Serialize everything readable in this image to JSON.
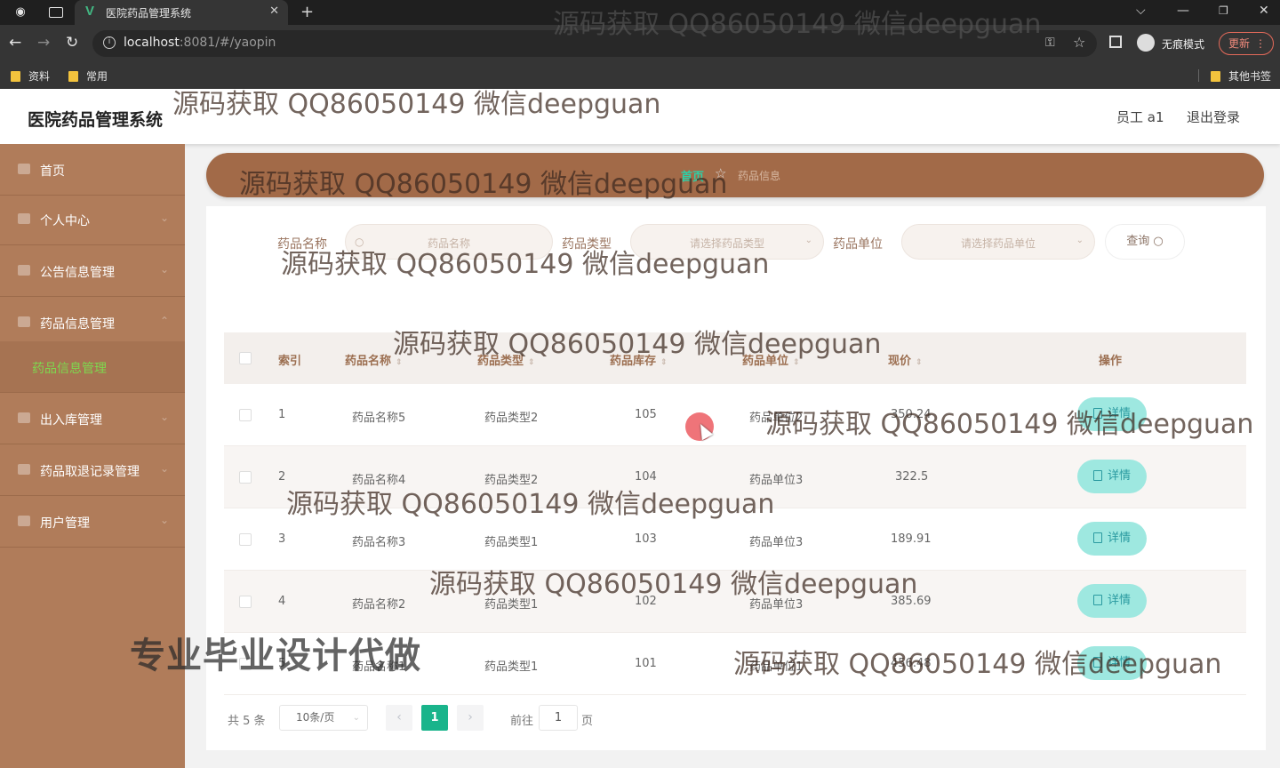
{
  "browser": {
    "tab_title": "医院药品管理系统",
    "url_host": "localhost",
    "url_rest": ":8081/#/yaopin",
    "incognito_label": "无痕模式",
    "update_label": "更新",
    "bookmarks": [
      "资料",
      "常用"
    ],
    "other_bookmarks": "其他书签"
  },
  "header": {
    "title": "医院药品管理系统",
    "user": "员工 a1",
    "logout": "退出登录"
  },
  "sidebar": {
    "items": [
      {
        "label": "首页"
      },
      {
        "label": "个人中心"
      },
      {
        "label": "公告信息管理"
      },
      {
        "label": "药品信息管理"
      },
      {
        "label": "出入库管理"
      },
      {
        "label": "药品取退记录管理"
      },
      {
        "label": "用户管理"
      }
    ],
    "active_sub": "药品信息管理"
  },
  "breadcrumb": {
    "home": "首页",
    "current": "药品信息"
  },
  "filters": {
    "name_label": "药品名称",
    "name_placeholder": "药品名称",
    "type_label": "药品类型",
    "type_placeholder": "请选择药品类型",
    "unit_label": "药品单位",
    "unit_placeholder": "请选择药品单位",
    "query_button": "查询"
  },
  "table": {
    "headers": [
      "索引",
      "药品名称",
      "药品类型",
      "药品库存",
      "药品单位",
      "现价",
      "操作"
    ],
    "rows": [
      {
        "index": "1",
        "name": "药品名称5",
        "type": "药品类型2",
        "stock": "105",
        "unit": "药品单位2",
        "price": "350.24",
        "action": "详情"
      },
      {
        "index": "2",
        "name": "药品名称4",
        "type": "药品类型2",
        "stock": "104",
        "unit": "药品单位3",
        "price": "322.5",
        "action": "详情"
      },
      {
        "index": "3",
        "name": "药品名称3",
        "type": "药品类型1",
        "stock": "103",
        "unit": "药品单位3",
        "price": "189.91",
        "action": "详情"
      },
      {
        "index": "4",
        "name": "药品名称2",
        "type": "药品类型1",
        "stock": "102",
        "unit": "药品单位3",
        "price": "385.69",
        "action": "详情"
      },
      {
        "index": "5",
        "name": "药品名称1",
        "type": "药品类型1",
        "stock": "101",
        "unit": "药品单位1",
        "price": "456.48",
        "action": "详情"
      }
    ]
  },
  "pagination": {
    "total": "共 5 条",
    "page_size": "10条/页",
    "current_page": "1",
    "goto_label": "前往",
    "goto_value": "1",
    "goto_unit": "页"
  },
  "watermarks": {
    "repeat": "源码获取 QQ86050149 微信deepguan",
    "promo": "专业毕业设计代做"
  }
}
